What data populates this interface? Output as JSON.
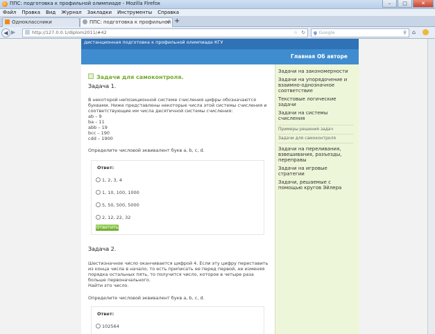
{
  "window": {
    "title": "ППС: подготовка к профильной олимпиаде - Mozilla Firefox"
  },
  "menu": [
    "Файл",
    "Правка",
    "Вид",
    "Журнал",
    "Закладки",
    "Инструменты",
    "Справка"
  ],
  "tabs": [
    {
      "label": "Одноклассники"
    },
    {
      "label": "ППС: подготовка к профильной ол..."
    }
  ],
  "address": {
    "url": "http://127.0.0.1/diplom2011/#42"
  },
  "search": {
    "placeholder": "Google"
  },
  "site": {
    "subtitle": "дистанционная подготовка к профильной олимпиаде КГУ",
    "nav": [
      "Главная",
      "Об авторе"
    ]
  },
  "section_title": "Задачи для самоконтроля.",
  "task1": {
    "title": "Задача 1.",
    "text": "В некоторой непозиционной системе счисления цифры обозначаются буквами. Ниже представлены некоторые числа этой системы счисления и соответствующие им числа десятичной системы счисления:",
    "lines": [
      "ab – 9",
      "ba – 11",
      "abb – 19",
      "bcc – 190",
      "cdd – 1900"
    ],
    "question": "Определите числовой эквивалент букв a, b, c, d.",
    "answer_label": "Ответ:",
    "options": [
      "1, 2, 3, 4",
      "1, 10, 100, 1000",
      "5, 50, 500, 5000",
      "2, 12, 22, 32"
    ],
    "submit": "Ответить"
  },
  "task2": {
    "title": "Задача 2.",
    "text": "Шестизначное число оканчивается цифрой 4. Если эту цифру переставить из конца числа в начало, то есть приписать ее перед первой, не изменяя порядка остальных пять, то получится число, которое в четыре раза больше первоначального.",
    "find": "Найти это число.",
    "question": "Определите числовой эквивалент букв a, b, c, d.",
    "answer_label": "Ответ:",
    "options": [
      "102564"
    ]
  },
  "sidebar": {
    "items": [
      "Задачи на закономерности",
      "Задачи на упорядочение и взаимно-однозначное соответствие",
      "Текстовые логические задачи",
      "Задачи на системы счисления",
      "Примеры решения задач",
      "Задачи для самоконтроля",
      "Задачи на переливания, взвешивания, разъезды, переправы",
      "Задачи на игровые стратегии",
      "Задачи, решаемые с помощью кругов Эйлера"
    ]
  }
}
